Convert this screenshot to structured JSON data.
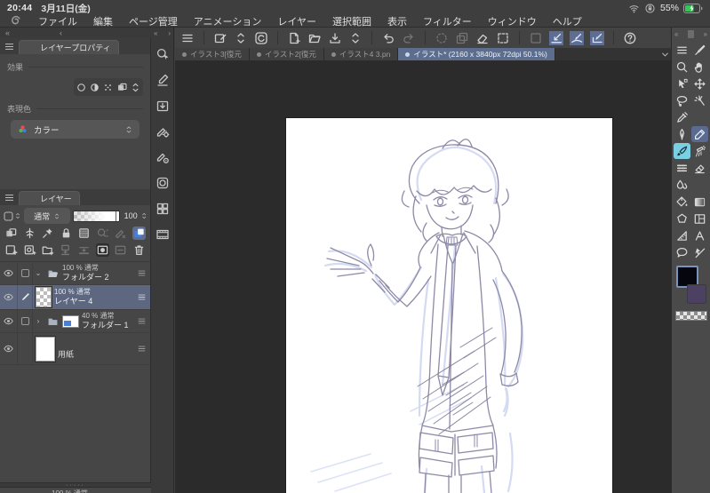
{
  "status_bar": {
    "time": "20:44",
    "date": "3月11日(金)",
    "battery_percent": "55%"
  },
  "menu_bar": {
    "items": [
      "ファイル",
      "編集",
      "ページ管理",
      "アニメーション",
      "レイヤー",
      "選択範囲",
      "表示",
      "フィルター",
      "ウィンドウ",
      "ヘルプ"
    ]
  },
  "command_bar": {
    "items": [
      {
        "icon": "hamburger-menu"
      },
      {
        "sep": true
      },
      {
        "icon": "edit-canvas"
      },
      {
        "icon": "updown-chevrons"
      },
      {
        "icon": "clip-studio-logo"
      },
      {
        "sep": true
      },
      {
        "icon": "new-document"
      },
      {
        "icon": "open-folder"
      },
      {
        "icon": "save-document"
      },
      {
        "icon": "updown-chevrons"
      },
      {
        "sep": true
      },
      {
        "icon": "undo"
      },
      {
        "icon": "redo",
        "state": "dim"
      },
      {
        "sep": true
      },
      {
        "icon": "spinner",
        "state": "dim"
      },
      {
        "icon": "duplicate",
        "state": "dim"
      },
      {
        "icon": "clear-selection"
      },
      {
        "icon": "select-frame"
      },
      {
        "sep": true
      },
      {
        "icon": "no-snap",
        "state": "dim"
      },
      {
        "icon": "snap-ruler",
        "state": "active"
      },
      {
        "icon": "snap-special-ruler",
        "state": "active"
      },
      {
        "icon": "snap-grid",
        "state": "active"
      },
      {
        "sep": true
      },
      {
        "icon": "help"
      }
    ]
  },
  "dock": {
    "icons": [
      {
        "icon": "navigator"
      },
      {
        "icon": "subtool"
      },
      {
        "icon": "import-box"
      },
      {
        "icon": "tool-property"
      },
      {
        "icon": "subtool-detail"
      },
      {
        "icon": "material"
      },
      {
        "icon": "all-panels"
      },
      {
        "icon": "timeline"
      }
    ]
  },
  "tab_bar": {
    "tabs": [
      {
        "label": "イラスト3[復元"
      },
      {
        "label": "イラスト2[復元"
      },
      {
        "label": "イラスト4 3.pn"
      },
      {
        "label": "イラスト* (2160 x 3840px 72dpi 50.1%)"
      }
    ]
  },
  "layer_property_panel": {
    "title": "レイヤープロパティ",
    "effect_label": "効果",
    "expression_label": "表現色",
    "color_mode_value": "カラー",
    "effect_icons": [
      {
        "icon": "edge-circle"
      },
      {
        "icon": "tone-half"
      },
      {
        "icon": "tone-dots"
      },
      {
        "icon": "layer-color-combine"
      },
      {
        "icon": "updown-chevrons"
      }
    ]
  },
  "layer_panel": {
    "title": "レイヤー",
    "blend_mode_value": "通常",
    "opacity_value": "100",
    "toggle_icons": [
      {
        "icon": "combine-squares"
      },
      {
        "icon": "clip-below"
      },
      {
        "icon": "reference-pin"
      },
      {
        "icon": "lock"
      },
      {
        "icon": "lock-alpha"
      },
      {
        "icon": "draft-chevrons",
        "state": "dim"
      },
      {
        "icon": "ruler-x-chevrons",
        "state": "dim"
      },
      {
        "icon": "layer-color-chevrons",
        "state": "activeblue"
      }
    ],
    "action_icons": [
      {
        "icon": "new-layer"
      },
      {
        "icon": "new-layer-settings"
      },
      {
        "icon": "new-folder"
      },
      {
        "icon": "transfer-down",
        "state": "dim"
      },
      {
        "icon": "merge-down",
        "state": "dim"
      },
      {
        "icon": "layer-mask",
        "state": "dark"
      },
      {
        "icon": "mask-enable",
        "state": "dim"
      },
      {
        "icon": "delete-layer"
      }
    ],
    "layers": [
      {
        "info": "100 % 通常",
        "name": "フォルダー 2"
      },
      {
        "info": "100 % 通常",
        "name": "レイヤー 4"
      },
      {
        "info": "40 % 通常",
        "name": "フォルダー 1"
      },
      {
        "info": "",
        "name": "用紙"
      }
    ],
    "partial_row_text": "100 % 通常"
  },
  "tools": {
    "rows": [
      [
        {
          "icon": "hamburger-menu"
        },
        {
          "icon": "pen-line"
        }
      ],
      [
        {
          "icon": "magnifier"
        },
        {
          "icon": "hand"
        }
      ],
      [
        {
          "icon": "operate-cursor"
        },
        {
          "icon": "move-arrows"
        }
      ],
      [
        {
          "icon": "lasso"
        },
        {
          "icon": "magic-wand"
        }
      ],
      [
        {
          "icon": "eyedropper"
        },
        {
          "blank": true
        }
      ],
      [
        {
          "icon": "dip-pen"
        },
        {
          "icon": "pencil",
          "state": "selected"
        }
      ],
      [
        {
          "icon": "brush",
          "state": "accent"
        },
        {
          "icon": "airbrush"
        }
      ],
      [
        {
          "icon": "decoration-lines"
        },
        {
          "icon": "eraser"
        }
      ],
      [
        {
          "icon": "blend-drop"
        },
        {
          "blank": true
        }
      ],
      [
        {
          "icon": "fill-bucket"
        },
        {
          "icon": "gradient"
        }
      ],
      [
        {
          "icon": "figure-shape"
        },
        {
          "icon": "frame-border"
        }
      ],
      [
        {
          "icon": "ruler"
        },
        {
          "icon": "text-tool"
        }
      ],
      [
        {
          "icon": "balloon"
        },
        {
          "icon": "correct-line"
        }
      ]
    ]
  },
  "colors": {
    "accent_blue": "#5d6d8e",
    "selected_row": "#5d6880",
    "tool_selected": "#5b6b8f",
    "tool_accent": "#7ad0e2",
    "main_color": "#06060e",
    "sub_color": "#4c4163"
  }
}
